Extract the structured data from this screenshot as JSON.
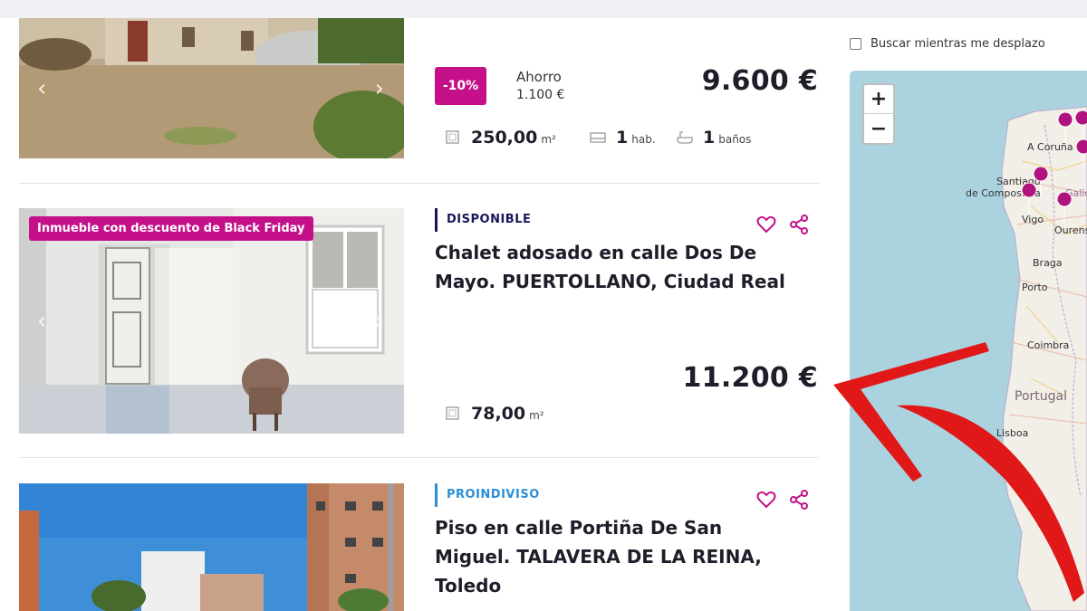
{
  "listing1": {
    "discount": "-10%",
    "saving_label": "Ahorro",
    "saving_value": "1.100 €",
    "price": "9.600 €",
    "area_value": "250,00",
    "area_unit": "m²",
    "rooms_value": "1",
    "rooms_unit": "hab.",
    "baths_value": "1",
    "baths_unit": "baños"
  },
  "listing2": {
    "badge": "Inmueble con descuento de Black Friday",
    "status": "DISPONIBLE",
    "title": "Chalet adosado en calle Dos De Mayo. PUERTOLLANO, Ciudad Real",
    "price": "11.200 €",
    "area_value": "78,00",
    "area_unit": "m²"
  },
  "listing3": {
    "status": "PROINDIVISO",
    "title": "Piso en calle Portiña De San Miguel. TALAVERA DE LA REINA, Toledo"
  },
  "map": {
    "scroll_search_label": "Buscar mientras me desplazo",
    "zoom_in": "+",
    "zoom_out": "−",
    "cities": {
      "coruna": "A Coruña",
      "santiago1": "Santiago",
      "santiago2": "de Compostela",
      "galicia": "Galicia",
      "vigo": "Vigo",
      "ourense": "Ourens",
      "braga": "Braga",
      "porto": "Porto",
      "coimbra": "Coimbra",
      "portugal": "Portugal",
      "lisboa": "Lisboa"
    }
  },
  "colors": {
    "accent": "#c4118a",
    "status_available": "#16185a",
    "status_shared": "#2a8fd8",
    "map_sea": "#aad3df",
    "annotation_arrow": "#e01818"
  }
}
